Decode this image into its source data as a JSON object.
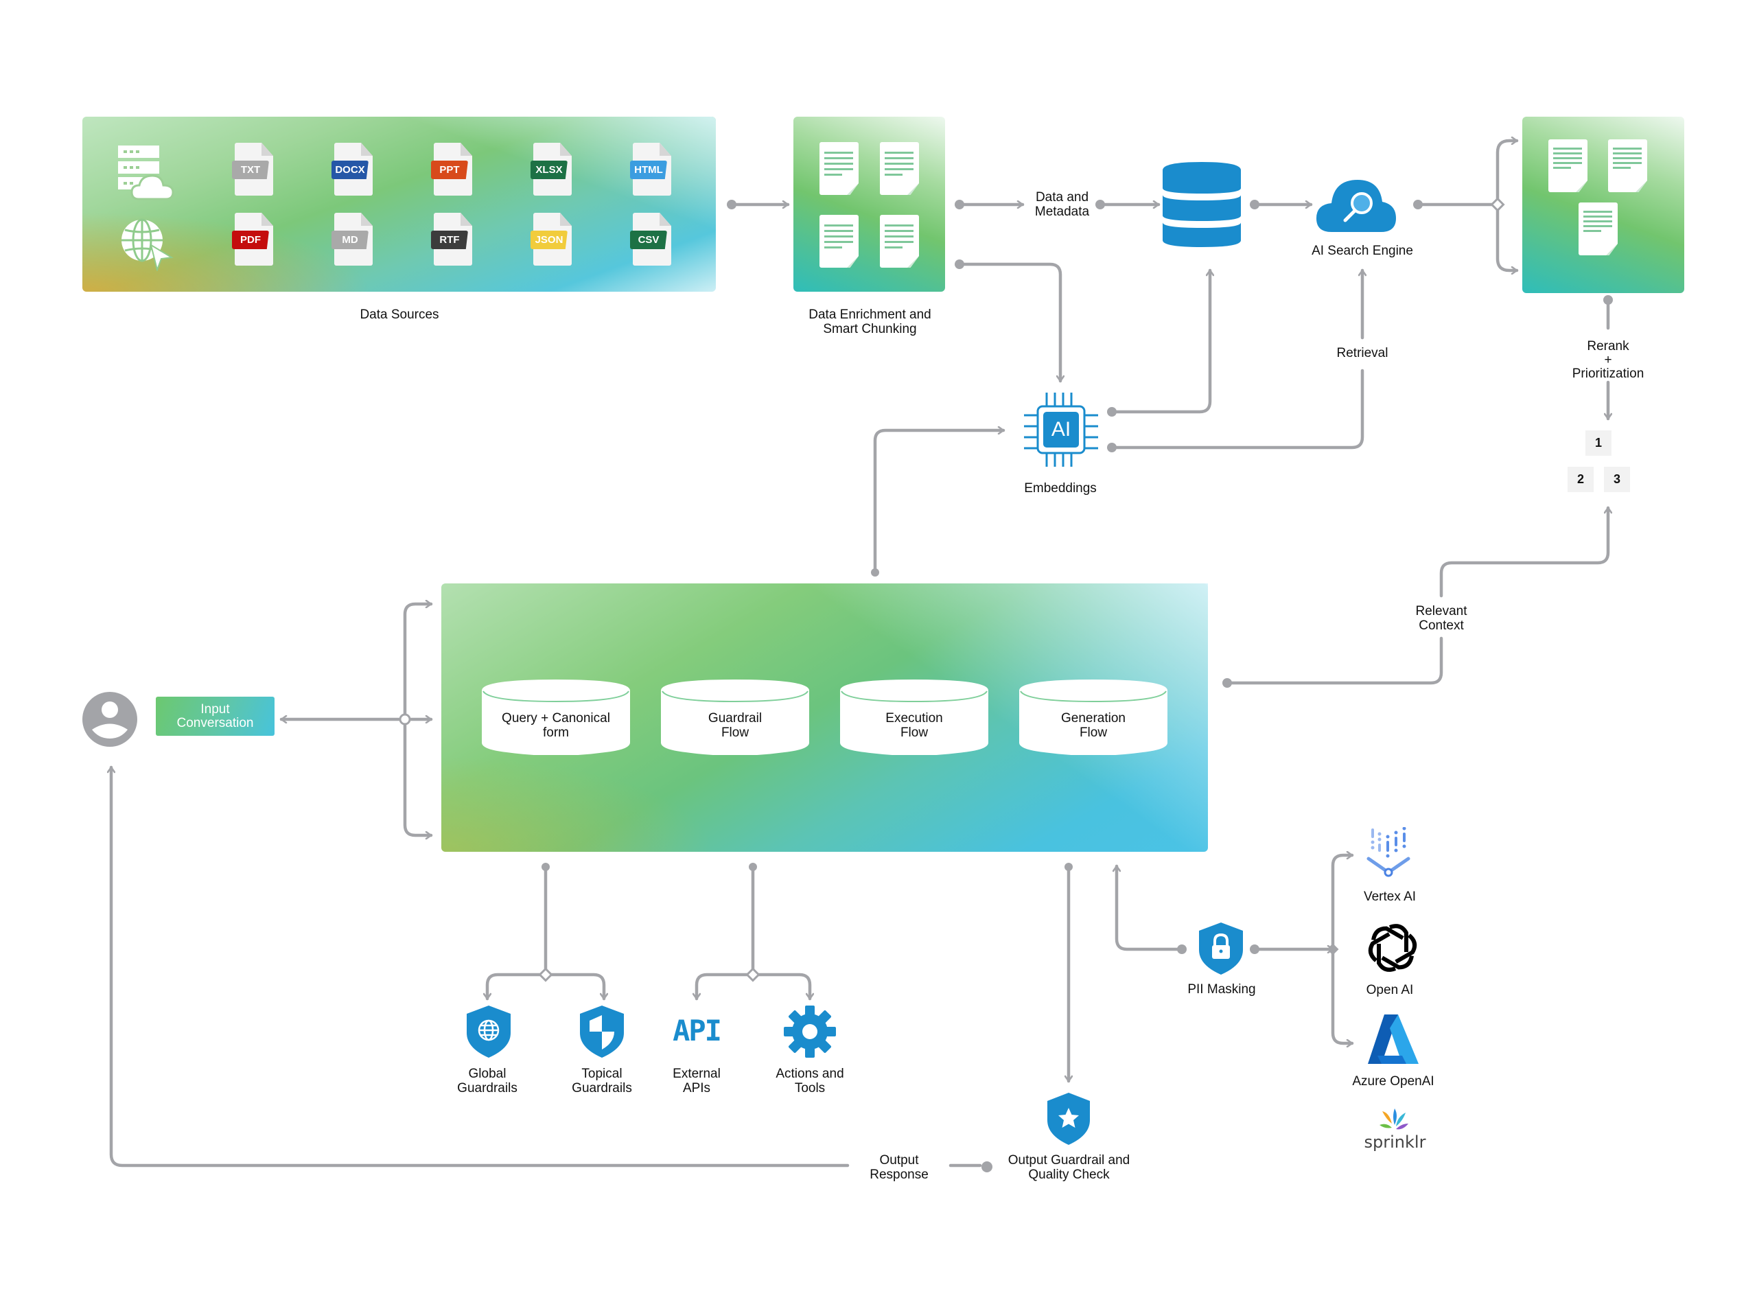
{
  "colors": {
    "connector": "#a3a4a8",
    "icon_blue": "#1a8ccd",
    "text": "#111111"
  },
  "data_sources": {
    "label": "Data Sources",
    "source_icons": [
      "server-cloud-icon",
      "globe-cursor-icon"
    ],
    "files": [
      {
        "ext": "TXT",
        "color": "#a9a9a9"
      },
      {
        "ext": "DOCX",
        "color": "#2557a7"
      },
      {
        "ext": "PPT",
        "color": "#d84a1b"
      },
      {
        "ext": "XLSX",
        "color": "#1d7145"
      },
      {
        "ext": "HTML",
        "color": "#3b9de0"
      },
      {
        "ext": "PDF",
        "color": "#c40d0d"
      },
      {
        "ext": "MD",
        "color": "#a9a9a9"
      },
      {
        "ext": "RTF",
        "color": "#3c3c3c"
      },
      {
        "ext": "JSON",
        "color": "#f1cc3c"
      },
      {
        "ext": "CSV",
        "color": "#1d7145"
      }
    ]
  },
  "enrichment": {
    "label": "Data Enrichment and\nSmart Chunking"
  },
  "data_metadata": {
    "label": "Data and\nMetadata"
  },
  "search_engine": {
    "label": "AI Search Engine"
  },
  "retrieval": {
    "label": "Retrieval"
  },
  "embeddings": {
    "label": "Embeddings",
    "chip_text": "AI"
  },
  "rerank": {
    "label": "Rerank\n+\nPrioritization",
    "ranks": [
      "1",
      "2",
      "3"
    ]
  },
  "relevant_context": {
    "label": "Relevant\nContext"
  },
  "input_conversation": {
    "label": "Input\nConversation"
  },
  "flows": [
    {
      "label": "Query + Canonical\nform"
    },
    {
      "label": "Guardrail\nFlow"
    },
    {
      "label": "Execution\nFlow"
    },
    {
      "label": "Generation\nFlow"
    }
  ],
  "tools": [
    {
      "label": "Global\nGuardrails",
      "icon": "globe-shield-icon"
    },
    {
      "label": "Topical\nGuardrails",
      "icon": "shield-icon"
    },
    {
      "label": "External\nAPIs",
      "icon": "api-icon",
      "icon_text": "API"
    },
    {
      "label": "Actions and\nTools",
      "icon": "gear-icon"
    }
  ],
  "pii_masking": {
    "label": "PII Masking"
  },
  "llm_providers": [
    {
      "label": "Vertex AI"
    },
    {
      "label": "Open AI"
    },
    {
      "label": "Azure OpenAI"
    },
    {
      "label": "sprinklr"
    }
  ],
  "output_response": {
    "label": "Output\nResponse"
  },
  "output_guardrail": {
    "label": "Output Guardrail and\nQuality Check"
  }
}
